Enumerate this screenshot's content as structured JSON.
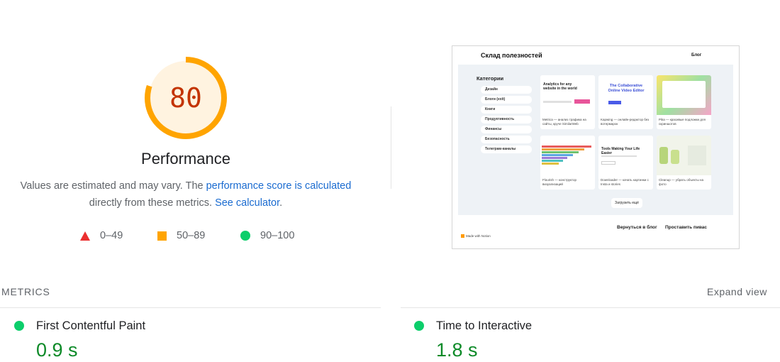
{
  "score": {
    "value": 80,
    "label": "Performance",
    "fraction": 0.8,
    "ring_color": "#ffa400",
    "ring_bg": "#fff3e0",
    "text_color": "#c33300"
  },
  "description": {
    "part1": "Values are estimated and may vary. The ",
    "link1": "performance score is calculated",
    "part2": "directly from these metrics. ",
    "link2": "See calculator",
    "part3": "."
  },
  "legend": [
    {
      "symbol": "red-triangle",
      "label": "0–49",
      "color": "#eb2f2f"
    },
    {
      "symbol": "orange-square",
      "label": "50–89",
      "color": "#ffa400"
    },
    {
      "symbol": "green-circle",
      "label": "90–100",
      "color": "#0cce6b"
    }
  ],
  "screenshot": {
    "site_title": "Склад полезностей",
    "blog_link": "Блог",
    "categories_title": "Категории",
    "categories": [
      "Дизайн",
      "Блоги (exit)",
      "Книги",
      "Продуктивность",
      "Финансы",
      "Безопасность",
      "Телеграм-каналы"
    ],
    "cards": [
      {
        "heading": "Analytics for any website in the world",
        "caption": "Metrica — анализ трафика на сайты, круче SimilarWeb"
      },
      {
        "heading": "The Collaborative Online Video Editor",
        "caption": "Kapwing — онлайн-редактор без вотермарок"
      },
      {
        "heading": "",
        "caption": "Pika — красивые подложки для скриншотов"
      },
      {
        "heading": "",
        "caption": "Flourish — конструктор визуализаций"
      },
      {
        "heading": "Tools Making Your Life Easier",
        "caption": "Downloader — качать картинки с Insta и stories"
      },
      {
        "heading": "",
        "caption": "Cleanup — убрать объекты на фото"
      }
    ],
    "load_more": "Загрузить ещё",
    "footer_link1": "Вернуться в блог",
    "footer_link2": "Проставить пивас",
    "made_with": "Made with Notion"
  },
  "metrics": {
    "title": "METRICS",
    "expand_label": "Expand view",
    "items": [
      {
        "name": "First Contentful Paint",
        "value": "0.9 s",
        "status_color": "#0cce6b"
      },
      {
        "name": "Time to Interactive",
        "value": "1.8 s",
        "status_color": "#0cce6b"
      }
    ]
  }
}
